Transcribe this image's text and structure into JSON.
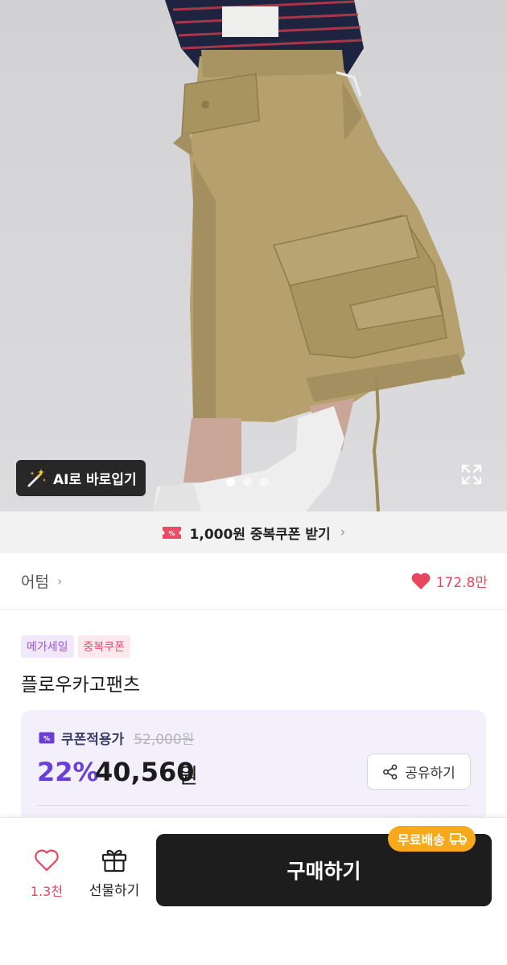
{
  "hero": {
    "ai_button_label": "AI로 바로입기",
    "carousel": {
      "count": 3,
      "active_index": 0
    }
  },
  "coupon_banner": {
    "text": "1,000원 중복쿠폰 받기",
    "arrow": "›"
  },
  "brand_row": {
    "brand": "어텀",
    "arrow": "›",
    "likes": "172.8만"
  },
  "tags": [
    "메가세일",
    "중복쿠폰"
  ],
  "product": {
    "title": "플로우카고팬츠"
  },
  "price": {
    "coupon_label": "쿠폰적용가",
    "original": "52,000원",
    "discount": "22%",
    "final": "40,560",
    "currency": "원",
    "share_label": "공유하기"
  },
  "action_bar": {
    "wish_count": "1.3천",
    "gift_label": "선물하기",
    "buy_label": "구매하기",
    "free_shipping": "무료배송"
  },
  "colors": {
    "accent_purple": "#6a3fd8",
    "like_pink": "#e8455f",
    "free_ship_orange": "#f6a91a",
    "buy_black": "#1d1d1d"
  },
  "icons": [
    "magic-wand-icon",
    "expand-icon",
    "coupon-ticket-icon",
    "heart-icon",
    "share-icon",
    "gift-icon",
    "truck-icon"
  ]
}
